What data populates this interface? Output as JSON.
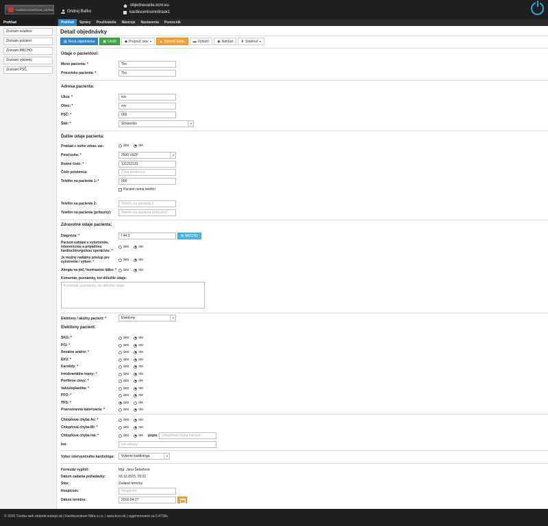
{
  "header": {
    "logo_text": "KARDIOCENTRUM | NITRA",
    "user_name": "Ondrej Baľko",
    "site_link": "objednavanie.kcnr.eu",
    "server_name": "kardiocentrumnitrask1"
  },
  "nav": {
    "side_title": "Prehľad",
    "tabs": [
      "Prehľad",
      "Správy",
      "Používatelia",
      "Nástroje",
      "Nastavenia",
      "Pomocník"
    ]
  },
  "sidebar": {
    "items": [
      "Zoznam sviatkov",
      "Zoznam poistení",
      "Zoznam MKCHO",
      "Zoznam výkonov",
      "Zoznam PSČ"
    ]
  },
  "page": {
    "title": "Detail objednávky",
    "toolbar": {
      "new_order": "Nová objednávka",
      "save": "Uložiť",
      "switch_state": "Prepnúť stav",
      "create_copy": "Vytvoriť kópiu",
      "print": "Vytlačiť",
      "preview": "Náhľad",
      "download": "Stiahnuť"
    }
  },
  "patient": {
    "section": "Údaje o pacientovi:",
    "first_name_label": "Meno pacienta: *",
    "first_name": "Tks",
    "last_name_label": "Priezvisko pacienta: *",
    "last_name": "Tks"
  },
  "address": {
    "section": "Adresa pacienta:",
    "street_label": "Ulica: *",
    "street": "vvv",
    "city_label": "Obec: *",
    "city": "vvv",
    "zip_label": "PSČ: *",
    "zip": "000",
    "country_label": "Štát: *",
    "country": "Slovensko"
  },
  "other": {
    "section": "Ďalšie údaje pacienta:",
    "transfer_label": "Preklad z iného zdrav. zar.:",
    "insurer_label": "Poisťovňa: *",
    "insurer": "2500 VšZP",
    "birth_no_label": "Rodné číslo: *",
    "birth_no": "121212121",
    "policy_no_label": "Číslo poistenca:",
    "policy_no_ph": "Číslo poistenca",
    "phone1_label": "Telefón na pacienta 1: *",
    "phone1": "000",
    "no_phone": "Pacient nemá telefón",
    "phone2_label": "Telefón na pacienta 2:",
    "phone2_ph": "Telefón na pacienta 2",
    "phone_rel_label": "Telefón na pacienta (príbuzný):",
    "phone_rel_ph": "Telefón na pacienta (príbuzný)"
  },
  "health": {
    "section": "Zdravotné údaje pacienta:",
    "diagnosis_label": "Diagnóza: *",
    "diagnosis": "I 44.2",
    "mkcho_btn": "MKCHO",
    "consent_label": "Pacient súhlasí s vyšetrením, intervenciou a prípadnou kardiochirurgickou operáciou: *",
    "radial_label": "Je možný radiálny prístup pre vyšetrenie / výkon: *",
    "allergy_label": "Alergia na jód / kontrastnú látku: *",
    "comment_label": "Komentár, poznámky, iné dôležité údaje:",
    "comment_ph": "Komentár, poznámky, iné dôležité údaje"
  },
  "radio": {
    "yes": "áno",
    "no": "nie"
  },
  "elective": {
    "type_label": "Elektívny / akútny pacient: *",
    "type_value": "Elektívny",
    "section": "Elektívny pacient:",
    "rows": [
      {
        "label": "SKG: *",
        "yes": false
      },
      {
        "label": "PCI: *",
        "yes": false
      },
      {
        "label": "Renálne artérie: *",
        "yes": false
      },
      {
        "label": "EKV: *",
        "yes": false
      },
      {
        "label": "Karotídy: *",
        "yes": false
      },
      {
        "label": "Intrakraniálne tepny: *",
        "yes": false
      },
      {
        "label": "Periférne cievy: *",
        "yes": false
      },
      {
        "label": "Valvuloplastika: *",
        "yes": false
      },
      {
        "label": "PFO: *",
        "yes": false
      },
      {
        "label": "TKS: *",
        "yes": true
      },
      {
        "label": "Pravostranná katerizácia: *",
        "yes": false
      }
    ]
  },
  "valves": {
    "ao_label": "Chlopňová chyba Ao: *",
    "mi_label": "Chlopňová chyba Mi: *",
    "other_label": "Chlopňová chyba iná: *",
    "desc_label": "popis:",
    "desc_ph": "Chlopňová chyba iná text",
    "misc_label": "Iné:",
    "misc_ph": "Iné výkony"
  },
  "cardiologist": {
    "label": "Výber intervenčného kardiológa:",
    "value": "Vyberte kardiológa"
  },
  "meta": {
    "filled_label": "Formulár vyplnil:",
    "filled_by": "Mgr. Jana Šebešová",
    "date_label": "Dátum zadania požiadavky:",
    "date": "03.12.2015, 09:21",
    "state_label": "Stav:",
    "state": "Zadané termíny",
    "hosp_label": "Hospicom:",
    "hosp_ph": "Hospicom",
    "term_label": "Dátum termínu:",
    "term": "2016-04-27"
  },
  "footer": {
    "text": "© 2016 Tvorba web stránok:subejct.sk | Kardiocentrum Nitra s.r.o. | www.kcnr.sk | vygenerované za 0.4718s"
  },
  "colors": {
    "primary": "#2f86c7",
    "success": "#3fa63f",
    "warning": "#f0a13a",
    "info": "#4ab6dd",
    "dark": "#1f1f1f"
  }
}
